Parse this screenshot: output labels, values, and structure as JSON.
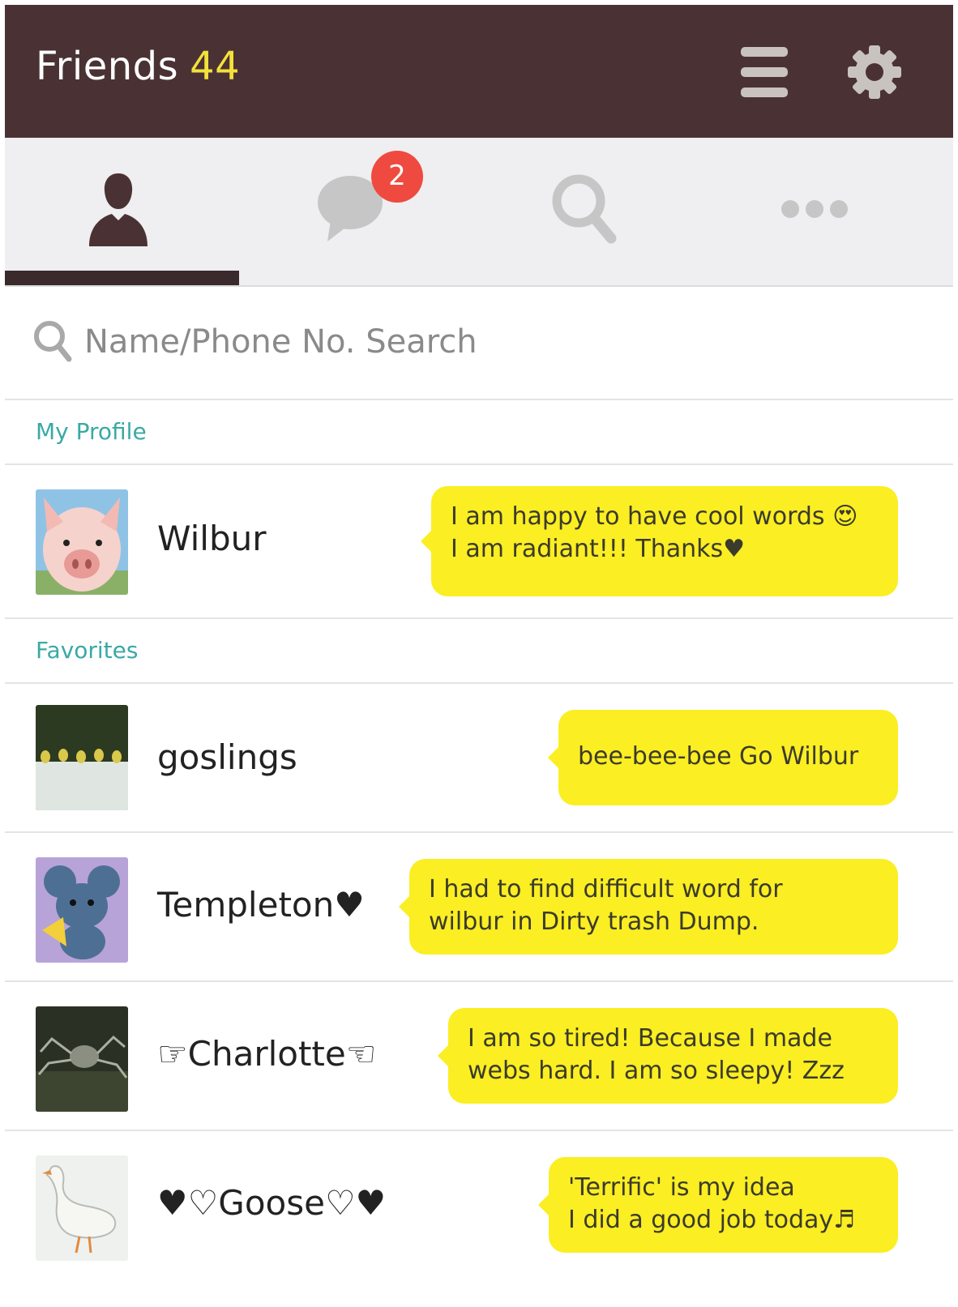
{
  "header": {
    "title": "Friends",
    "count": "44"
  },
  "tabs": {
    "chat_badge": "2"
  },
  "search": {
    "placeholder": "Name/Phone No. Search"
  },
  "sections": {
    "my_profile": "My Profile",
    "favorites": "Favorites"
  },
  "profile": {
    "name": "Wilbur",
    "status_line1": "I am happy to have cool words 😍",
    "status_line2": "I am radiant!!! Thanks♥"
  },
  "friends": [
    {
      "name": "goslings",
      "status_line1": "bee-bee-bee  Go Wilbur",
      "status_line2": ""
    },
    {
      "name": "Templeton♥",
      "status_line1": "I had to find difficult word for",
      "status_line2": "wilbur in Dirty trash Dump."
    },
    {
      "name": "☞Charlotte☜",
      "status_line1": "I am so tired! Because I made",
      "status_line2": "webs hard. I am so sleepy! Zzz"
    },
    {
      "name": "♥♡Goose♡♥",
      "status_line1": "'Terrific' is my idea",
      "status_line2": "I did a good job today♬"
    }
  ],
  "colors": {
    "header_bg": "#4a3234",
    "count": "#f2e23a",
    "accent_teal": "#3aa9a6",
    "bubble": "#fbee22",
    "badge": "#ef4a3f"
  },
  "icons": [
    "menu-icon",
    "gear-icon",
    "friends-person-icon",
    "chat-bubble-icon",
    "search-icon",
    "more-dots-icon"
  ]
}
